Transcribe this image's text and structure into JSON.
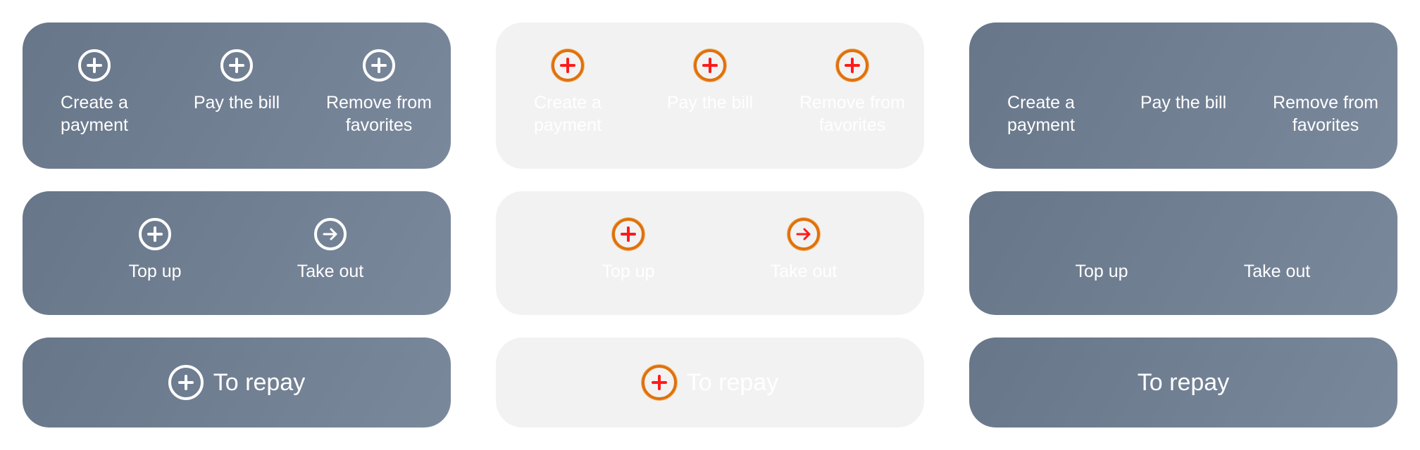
{
  "variants": [
    {
      "state": "default",
      "card1": {
        "actions": [
          {
            "label": "Create a\npayment",
            "icon": "plus-circle-icon"
          },
          {
            "label": "Pay the bill",
            "icon": "plus-circle-icon"
          },
          {
            "label": "Remove from\nfavorites",
            "icon": "plus-circle-icon"
          }
        ]
      },
      "card2": {
        "actions": [
          {
            "label": "Top up",
            "icon": "plus-circle-icon"
          },
          {
            "label": "Take out",
            "icon": "arrow-right-circle-icon"
          }
        ]
      },
      "card3": {
        "label": "To repay",
        "icon": "plus-circle-icon"
      }
    },
    {
      "state": "light",
      "card1": {
        "actions": [
          {
            "label": "Create a\npayment",
            "icon": "plus-circle-icon"
          },
          {
            "label": "Pay the bill",
            "icon": "plus-circle-icon"
          },
          {
            "label": "Remove from\nfavorites",
            "icon": "plus-circle-icon"
          }
        ]
      },
      "card2": {
        "actions": [
          {
            "label": "Top up",
            "icon": "plus-circle-icon"
          },
          {
            "label": "Take out",
            "icon": "arrow-right-circle-icon"
          }
        ]
      },
      "card3": {
        "label": "To repay",
        "icon": "plus-circle-icon"
      }
    },
    {
      "state": "no-icons",
      "card1": {
        "actions": [
          {
            "label": "Create a\npayment"
          },
          {
            "label": "Pay the bill"
          },
          {
            "label": "Remove from\nfavorites"
          }
        ]
      },
      "card2": {
        "actions": [
          {
            "label": "Top up"
          },
          {
            "label": "Take out"
          }
        ]
      },
      "card3": {
        "label": "To repay"
      }
    }
  ],
  "colors": {
    "card_gradient_start": "#687689",
    "card_gradient_end": "#7a889c",
    "light_card": "#f2f2f2",
    "icon_highlight_ring": "#e0710c",
    "icon_highlight_glyph": "#ff1a1a"
  }
}
